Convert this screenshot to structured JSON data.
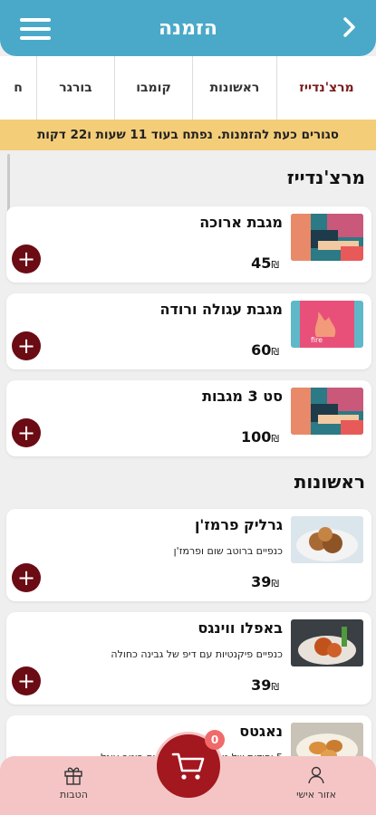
{
  "header": {
    "title": "הזמנה"
  },
  "tabs": [
    {
      "label": "מרצ'נדייז",
      "active": true
    },
    {
      "label": "ראשונות"
    },
    {
      "label": "קומבו"
    },
    {
      "label": "בורגר"
    },
    {
      "label": "ח"
    }
  ],
  "banner": {
    "text": "סגורים כעת להזמנות. נפתח בעוד 11 שעות ו22 דקות"
  },
  "sections": [
    {
      "title": "מרצ'נדייז",
      "items": [
        {
          "name": "מגבת ארוכה",
          "price": "45",
          "currency": "₪"
        },
        {
          "name": "מגבת עגולה ורודה",
          "price": "60",
          "currency": "₪"
        },
        {
          "name": "סט 3 מגבות",
          "price": "100",
          "currency": "₪"
        }
      ]
    },
    {
      "title": "ראשונות",
      "items": [
        {
          "name": "גרליק פרמז'ן",
          "desc": "כנפיים ברוטב שום ופרמז'ן",
          "price": "39",
          "currency": "₪"
        },
        {
          "name": "באפלו ווינגס",
          "desc": "כנפיים פיקנטיות עם דיפ של גבינה כחולה",
          "price": "39",
          "currency": "₪"
        },
        {
          "name": "נאגטס",
          "desc": "5 יחידות של נאגטס עוף ביתי עם רוטב עוגל",
          "price": "",
          "currency": ""
        }
      ]
    }
  ],
  "cart": {
    "count": "0"
  },
  "bottom_nav": {
    "personal": "אזור אישי",
    "benefits": "הטבות"
  },
  "colors": {
    "header": "#4aa9c9",
    "banner": "#f4cd79",
    "accent": "#6b0b14",
    "nav": "#f5c5c5",
    "cart": "#a3171f"
  }
}
